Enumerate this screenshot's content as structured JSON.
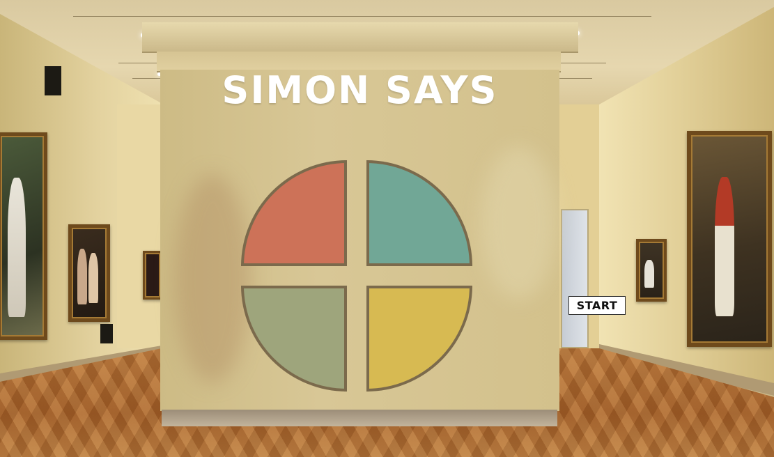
{
  "game": {
    "title": "SIMON SAYS",
    "start_label": "START"
  },
  "board": {
    "quadrants": [
      {
        "position": "top-left",
        "color": "#cd7258"
      },
      {
        "position": "top-right",
        "color": "#71a796"
      },
      {
        "position": "bottom-left",
        "color": "#9ea57c"
      },
      {
        "position": "bottom-right",
        "color": "#d7ba52"
      }
    ],
    "outline_color": "#7b6a4c"
  },
  "colors": {
    "title_text": "#ffffff",
    "partition": "#d4c28e",
    "floor": "#b0703a"
  }
}
